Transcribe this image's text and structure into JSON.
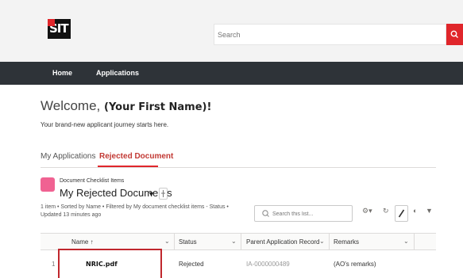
{
  "header": {
    "logo_text": "SIT",
    "search": {
      "placeholder": "Search",
      "value": ""
    }
  },
  "nav": {
    "items": [
      "Home",
      "Applications"
    ]
  },
  "welcome": {
    "prefix": "Welcome, ",
    "name": "(Your First Name)!",
    "subtitle": "Your brand-new applicant journey starts here."
  },
  "tabs": [
    {
      "label": "My Applications",
      "active": false
    },
    {
      "label": "Rejected Document",
      "active": true
    }
  ],
  "list": {
    "object_label": "Document Checklist Items",
    "title": "My Rejected Documents",
    "meta": "1 item • Sorted by Name • Filtered by My document checklist items - Status • Updated 13 minutes ago",
    "search_placeholder": "Search this list..."
  },
  "table": {
    "columns": [
      "Name",
      "Status",
      "Parent Application Record",
      "Remarks"
    ],
    "rows": [
      {
        "num": "1",
        "name": "NRIC.pdf",
        "status": "Rejected",
        "parent": "IA-0000000489",
        "remarks": "(AO's remarks)"
      }
    ]
  },
  "icons": [
    "search-icon",
    "pin-icon",
    "gear-icon",
    "refresh-icon",
    "edit-icon",
    "chart-icon",
    "filter-icon",
    "sort-up-icon",
    "chevron-down-icon"
  ],
  "colors": {
    "accent": "#e0262b",
    "navbar": "#2e3338",
    "list_icon": "#f06292"
  }
}
